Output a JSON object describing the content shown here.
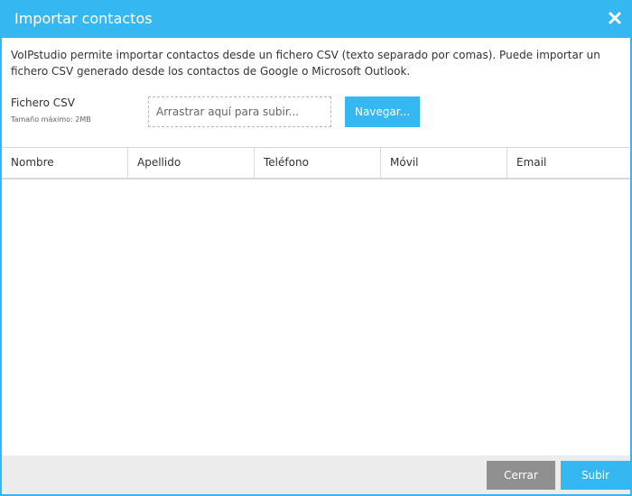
{
  "dialog": {
    "title": "Importar contactos",
    "close_icon": "close-icon",
    "description": "VoIPstudio permite importar contactos desde un fichero CSV (texto separado por comas). Puede importar un fichero CSV generado desde los contactos de Google o Microsoft Outlook."
  },
  "upload": {
    "label": "Fichero CSV",
    "hint": "Tamaño máximo: 2MB",
    "dropzone_text": "Arrastrar aquí para subir...",
    "browse_label": "Navegar..."
  },
  "table": {
    "columns": [
      "Nombre",
      "Apellido",
      "Teléfono",
      "Móvil",
      "Email"
    ]
  },
  "footer": {
    "close_label": "Cerrar",
    "upload_label": "Subir"
  },
  "colors": {
    "accent": "#35b8f2",
    "secondary_button": "#909090",
    "footer_bg": "#ececec"
  }
}
